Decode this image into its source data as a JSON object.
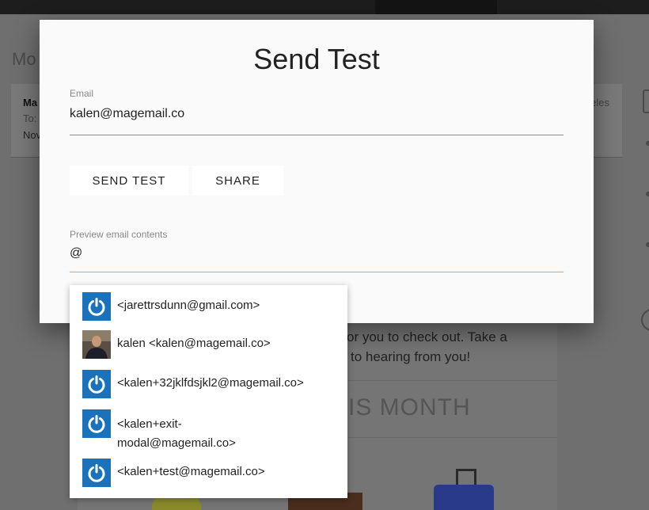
{
  "background": {
    "page_title": "Mo",
    "card": {
      "from": "Ma",
      "to": "To:",
      "date": "Nov",
      "right_text": "eles"
    },
    "body_text_line1": "or you to check out. Take a",
    "body_text_line2": "to hearing from you!",
    "section_heading": "IS MONTH"
  },
  "modal": {
    "title": "Send Test",
    "email_label": "Email",
    "email_value": "kalen@magemail.co",
    "send_test_label": "SEND TEST",
    "share_label": "SHARE",
    "preview_label": "Preview email contents",
    "preview_value": "@"
  },
  "dropdown": {
    "items": [
      {
        "text": "<jarettrsdunn@gmail.com>",
        "avatar": "power-icon"
      },
      {
        "text": "kalen <kalen@magemail.co>",
        "avatar": "user-photo"
      },
      {
        "text": "<kalen+32jklfdsjkl2@magemail.co>",
        "avatar": "power-icon"
      },
      {
        "text": "<kalen+exit-modal@magemail.co>",
        "text_line1": "<kalen+exit-",
        "text_line2": "modal@magemail.co>",
        "avatar": "power-icon"
      },
      {
        "text": "<kalen+test@magemail.co>",
        "avatar": "power-icon"
      }
    ]
  },
  "colors": {
    "accent_underline": "#e0a640",
    "avatar_blue": "#1a72bd"
  }
}
